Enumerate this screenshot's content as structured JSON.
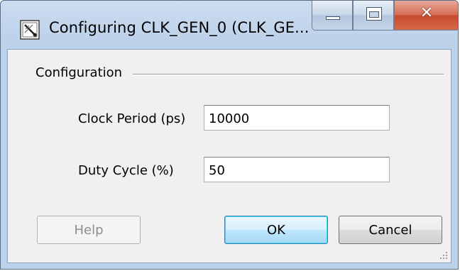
{
  "window": {
    "title": "Configuring CLK_GEN_0 (CLK_GE...",
    "app_icon": "wand-icon",
    "controls": {
      "minimize": "minimize-icon",
      "maximize": "maximize-icon",
      "close": "✕"
    }
  },
  "group": {
    "label": "Configuration"
  },
  "fields": {
    "clock_period": {
      "label": "Clock Period (ps)",
      "value": "10000"
    },
    "duty_cycle": {
      "label": "Duty Cycle (%)",
      "value": "50"
    }
  },
  "buttons": {
    "help": "Help",
    "ok": "OK",
    "cancel": "Cancel"
  },
  "colors": {
    "ok_focus_border": "#3c7fb1",
    "close_button": "#c44a2e",
    "titlebar": "#bcd1ea"
  }
}
